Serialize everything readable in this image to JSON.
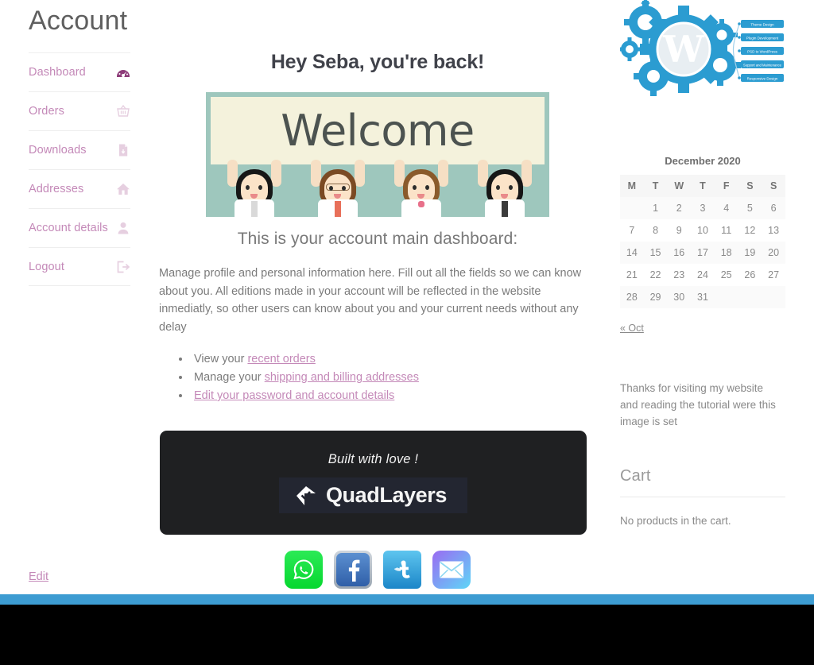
{
  "page": {
    "title": "Account",
    "edit_link": "Edit"
  },
  "account_nav": {
    "items": [
      {
        "label": "Dashboard",
        "icon": "dashboard-gauge-icon",
        "active": true
      },
      {
        "label": "Orders",
        "icon": "basket-icon",
        "active": false
      },
      {
        "label": "Downloads",
        "icon": "file-download-icon",
        "active": false
      },
      {
        "label": "Addresses",
        "icon": "home-icon",
        "active": false
      },
      {
        "label": "Account details",
        "icon": "user-icon",
        "active": false
      },
      {
        "label": "Logout",
        "icon": "sign-out-icon",
        "active": false
      }
    ]
  },
  "main": {
    "greeting": "Hey Seba, you're back!",
    "banner": {
      "alt": "welcome-banner-image",
      "word": "Welcome"
    },
    "dashboard_line": "This is your account main dashboard:",
    "paragraph": "Manage profile and personal information here. Fill out all the fields so we can know about you. All editions made in your account will be reflected in the website inmediatly, so other users can know about you and your current needs without any delay",
    "bullets": [
      {
        "prefix": "View your ",
        "link": "recent orders",
        "suffix": "",
        "all_link": false
      },
      {
        "prefix": "Manage your ",
        "link": "shipping and billing addresses",
        "suffix": "",
        "all_link": false
      },
      {
        "prefix": "",
        "link": "Edit your password and account details",
        "suffix": "",
        "all_link": true
      }
    ],
    "promo": {
      "tagline": "Built with love !",
      "wordmark": "QuadLayers",
      "mark_icon": "quadlayers-diamond-check-icon"
    },
    "social": [
      {
        "name": "whatsapp-share-button",
        "label": "WhatsApp"
      },
      {
        "name": "facebook-share-button",
        "label": "Facebook"
      },
      {
        "name": "twitter-share-button",
        "label": "Twitter"
      },
      {
        "name": "email-share-button",
        "label": "Email"
      }
    ]
  },
  "sidebar": {
    "image_widget": {
      "alt": "wordpress-gears-logo",
      "labels": [
        "Theme Design",
        "Plugin Development",
        "PSD to WordPress",
        "Support and Maintenance",
        "Responsive Design"
      ]
    },
    "calendar": {
      "caption": "December 2020",
      "weekdays": [
        "M",
        "T",
        "W",
        "T",
        "F",
        "S",
        "S"
      ],
      "weeks": [
        [
          "",
          "1",
          "2",
          "3",
          "4",
          "5",
          "6"
        ],
        [
          "7",
          "8",
          "9",
          "10",
          "11",
          "12",
          "13"
        ],
        [
          "14",
          "15",
          "16",
          "17",
          "18",
          "19",
          "20"
        ],
        [
          "21",
          "22",
          "23",
          "24",
          "25",
          "26",
          "27"
        ],
        [
          "28",
          "29",
          "30",
          "31",
          "",
          "",
          ""
        ]
      ],
      "prev_link": "« Oct"
    },
    "text_widget": "Thanks for visiting my website and reading the tutorial were this image is set",
    "cart": {
      "title": "Cart",
      "empty_message": "No products in the cart."
    }
  },
  "colors": {
    "link_mauve": "#c489b8",
    "heading_dark": "#40424a",
    "promo_bg": "#1f2022",
    "footer_accent": "#3d9cd2",
    "footer_black": "#000000",
    "banner_teal": "#9ec7bd",
    "banner_cream": "#f4f2dc"
  }
}
